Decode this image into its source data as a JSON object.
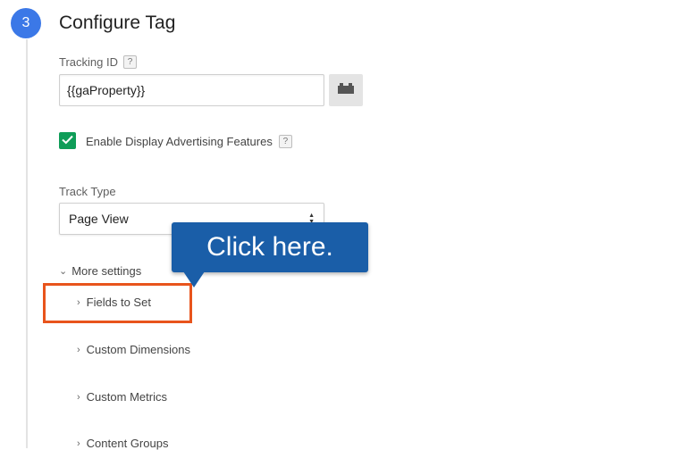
{
  "step": {
    "number": "3",
    "title": "Configure Tag"
  },
  "tracking": {
    "label": "Tracking ID",
    "help": "?",
    "value": "{{gaProperty}}",
    "variable_icon": "variable-picker-icon"
  },
  "display_ads": {
    "label": "Enable Display Advertising Features",
    "help": "?",
    "checked": true
  },
  "track_type": {
    "label": "Track Type",
    "selected": "Page View"
  },
  "more_settings": {
    "label": "More settings"
  },
  "sections": [
    "Fields to Set",
    "Custom Dimensions",
    "Custom Metrics",
    "Content Groups"
  ],
  "callout": {
    "text": "Click here."
  },
  "colors": {
    "step_badge": "#3b78e7",
    "checkbox": "#0f9d58",
    "callout": "#1a5ea8",
    "highlight": "#e8541c"
  }
}
